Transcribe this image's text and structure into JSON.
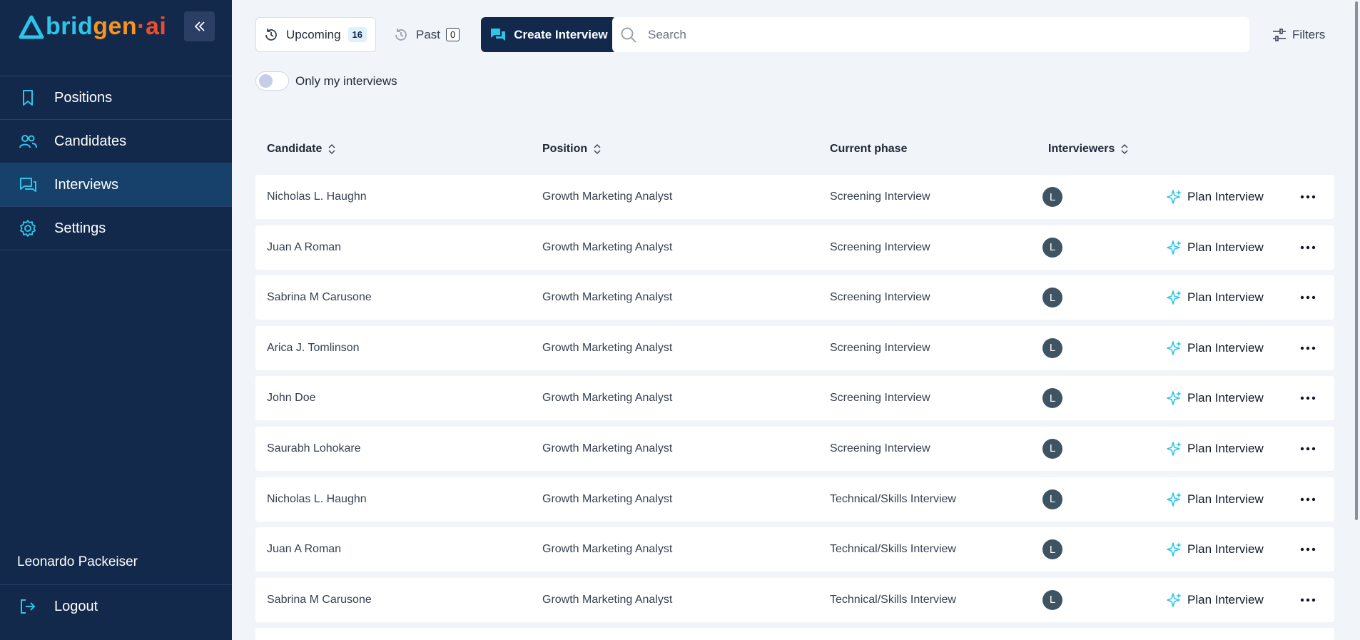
{
  "brand": {
    "logo_part1": "brid",
    "logo_part2": "gen",
    "logo_part3": "·ai"
  },
  "sidebar": {
    "items": [
      {
        "label": "Positions",
        "icon": "bookmark-icon"
      },
      {
        "label": "Candidates",
        "icon": "users-icon"
      },
      {
        "label": "Interviews",
        "icon": "chat-icon",
        "active": true
      },
      {
        "label": "Settings",
        "icon": "gear-icon"
      }
    ],
    "user_name": "Leonardo Packeiser",
    "logout_label": "Logout"
  },
  "toolbar": {
    "upcoming_label": "Upcoming",
    "upcoming_count": "16",
    "past_label": "Past",
    "past_count": "0",
    "create_label": "Create Interview",
    "search_placeholder": "Search",
    "filters_label": "Filters"
  },
  "toggle": {
    "label": "Only my interviews",
    "on": false
  },
  "table": {
    "headers": {
      "candidate": "Candidate",
      "position": "Position",
      "phase": "Current phase",
      "interviewers": "Interviewers"
    },
    "action_label": "Plan Interview",
    "rows": [
      {
        "candidate": "Nicholas L. Haughn",
        "position": "Growth Marketing Analyst",
        "phase": "Screening Interview",
        "interviewer": "L"
      },
      {
        "candidate": "Juan A Roman",
        "position": "Growth Marketing Analyst",
        "phase": "Screening Interview",
        "interviewer": "L"
      },
      {
        "candidate": "Sabrina M Carusone",
        "position": "Growth Marketing Analyst",
        "phase": "Screening Interview",
        "interviewer": "L"
      },
      {
        "candidate": "Arica J. Tomlinson",
        "position": "Growth Marketing Analyst",
        "phase": "Screening Interview",
        "interviewer": "L"
      },
      {
        "candidate": "John Doe",
        "position": "Growth Marketing Analyst",
        "phase": "Screening Interview",
        "interviewer": "L"
      },
      {
        "candidate": "Saurabh Lohokare",
        "position": "Growth Marketing Analyst",
        "phase": "Screening Interview",
        "interviewer": "L"
      },
      {
        "candidate": "Nicholas L. Haughn",
        "position": "Growth Marketing Analyst",
        "phase": "Technical/Skills Interview",
        "interviewer": "L"
      },
      {
        "candidate": "Juan A Roman",
        "position": "Growth Marketing Analyst",
        "phase": "Technical/Skills Interview",
        "interviewer": "L"
      },
      {
        "candidate": "Sabrina M Carusone",
        "position": "Growth Marketing Analyst",
        "phase": "Technical/Skills Interview",
        "interviewer": "L"
      }
    ]
  },
  "colors": {
    "sidebar_bg": "#13294b",
    "accent": "#2ec5e8",
    "active_nav": "#17406a",
    "page_bg": "#f1f4f9"
  }
}
